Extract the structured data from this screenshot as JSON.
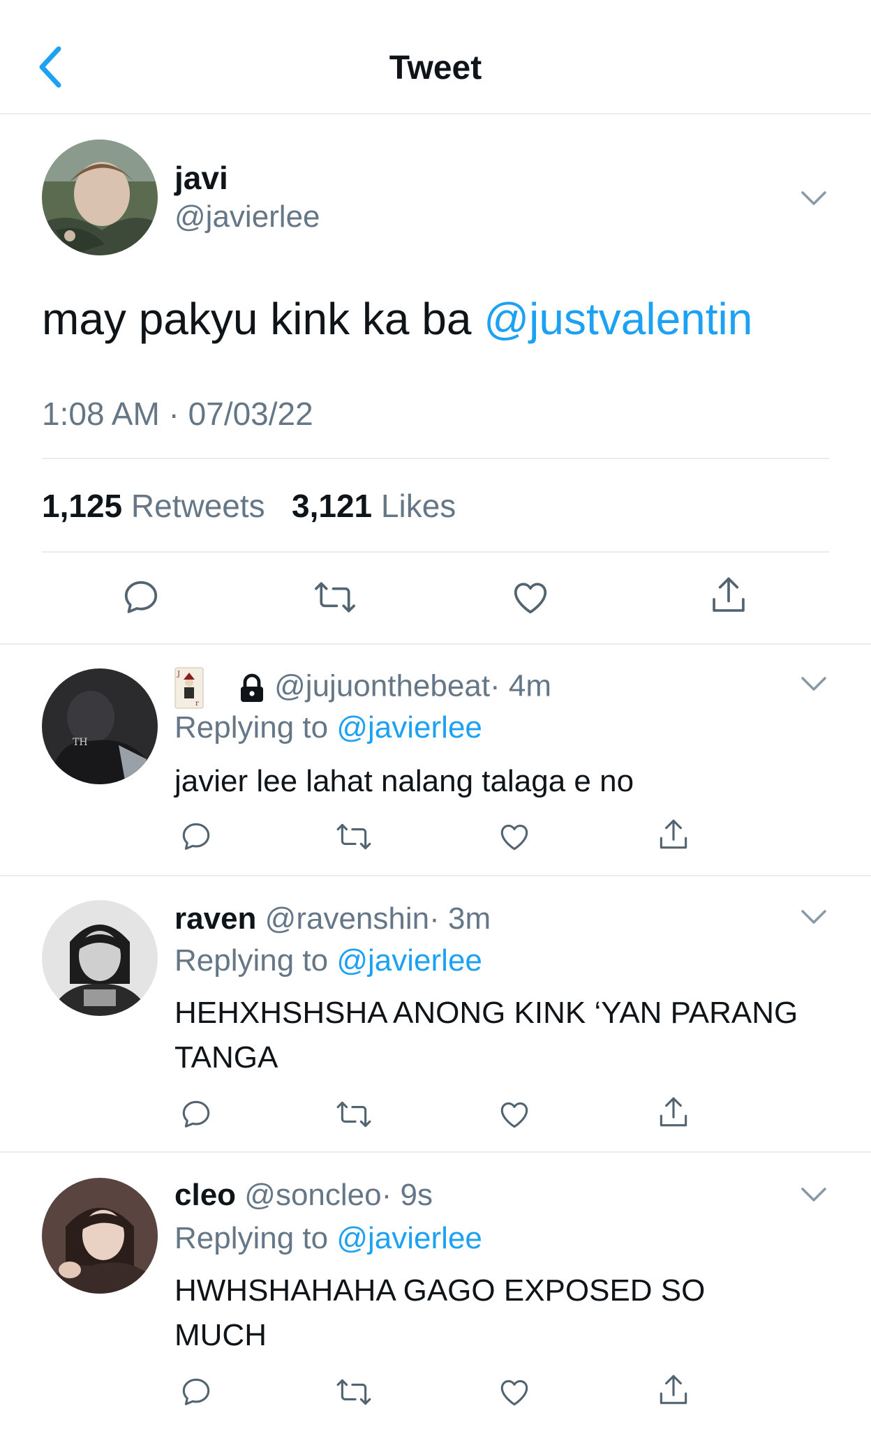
{
  "header": {
    "title": "Tweet"
  },
  "tweet": {
    "name": "javi",
    "handle": "@javierlee",
    "text": "may pakyu kink ka ba ",
    "mention": "@justvalentin",
    "timestamp": "1:08 AM · 07/03/22",
    "retweets_count": "1,125",
    "retweets_label": "Retweets",
    "likes_count": "3,121",
    "likes_label": "Likes"
  },
  "replies": [
    {
      "name": "",
      "handle": "@jujuonthebeat",
      "time": "· 4m",
      "replying_label": "Replying to ",
      "replying_to": "@javierlee",
      "text": "javier lee lahat nalang talaga e no"
    },
    {
      "name": "raven",
      "handle": "@ravenshin",
      "time": "· 3m",
      "replying_label": "Replying to ",
      "replying_to": "@javierlee",
      "text": "HEHXHSHSHA ANONG KINK ‘YAN PARANG TANGA"
    },
    {
      "name": "cleo",
      "handle": "@soncleo",
      "time": "· 9s",
      "replying_label": "Replying to ",
      "replying_to": "@javierlee",
      "text": "HWHSHAHAHA GAGO EXPOSED SO MUCH"
    }
  ],
  "colors": {
    "accent": "#1da1f2",
    "secondary_text": "#657786",
    "primary_text": "#0f1419",
    "divider": "#e6ecf0"
  },
  "icons": {
    "back": "chevron-left-icon",
    "more": "chevron-down-icon",
    "reply": "reply-icon",
    "retweet": "retweet-icon",
    "like": "heart-icon",
    "share": "share-icon",
    "lock": "lock-icon",
    "card": "joker-card-icon"
  }
}
